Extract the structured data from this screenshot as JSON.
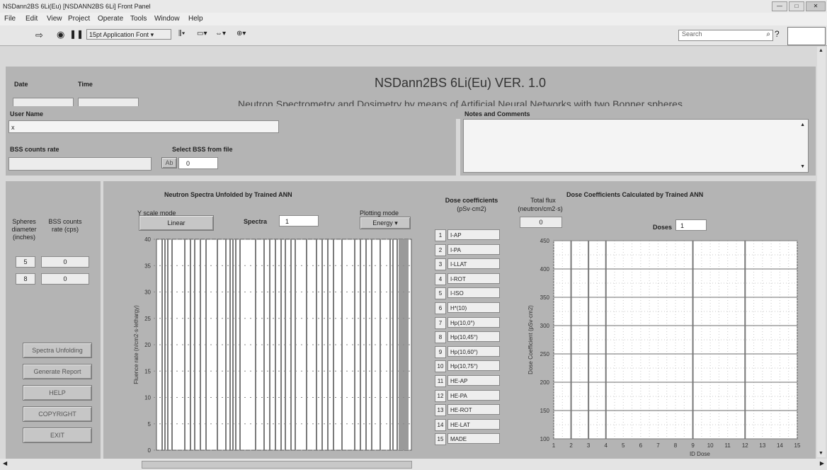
{
  "window": {
    "title": "NSDann2BS 6Li(Eu) [NSDANN2BS 6Li] Front Panel",
    "controls": [
      "—",
      "□",
      "✕"
    ]
  },
  "menu": [
    "File",
    "Edit",
    "View",
    "Project",
    "Operate",
    "Tools",
    "Window",
    "Help"
  ],
  "toolbar": {
    "font_select": "15pt Application Font",
    "search_placeholder": "Search"
  },
  "header": {
    "date_label": "Date",
    "time_label": "Time",
    "date_value": "",
    "time_value": "",
    "title": "NSDann2BS 6Li(Eu) VER. 1.0",
    "subtitle": "Neutron Spectrometry and Dosimetry by means of Artificial Neural Networks with two Bonner spheres"
  },
  "user": {
    "label": "User Name",
    "value": "x",
    "bss_label": "BSS counts rate",
    "bss_value": "",
    "select_label": "Select BSS from file",
    "select_button": "Ab",
    "select_value": "0"
  },
  "notes": {
    "label": "Notes and Comments",
    "value": ""
  },
  "spheres": {
    "header_diameter": "Spheres diameter (inches)",
    "header_counts": "BSS counts rate (cps)",
    "rows": [
      {
        "diameter": "5",
        "counts": "0"
      },
      {
        "diameter": "8",
        "counts": "0"
      }
    ]
  },
  "actions": [
    "Spectra Unfolding",
    "Generate Report",
    "HELP",
    "COPYRIGHT",
    "EXIT"
  ],
  "spectrum": {
    "title": "Neutron Spectra Unfolded by Trained ANN",
    "y_scale_label": "Y scale mode",
    "y_scale_value": "Linear",
    "spectra_label": "Spectra",
    "spectra_value": "1",
    "plotting_label": "Plotting mode",
    "plotting_value": "Energy",
    "ylabel": "Fluence rate (n/cm2·s·lethargy)"
  },
  "coefficients": {
    "title": "Dose coefficients",
    "unit": "(pSv·cm2)",
    "items": [
      {
        "n": "1",
        "name": "I-AP"
      },
      {
        "n": "2",
        "name": "I-PA"
      },
      {
        "n": "3",
        "name": "I-LLAT"
      },
      {
        "n": "4",
        "name": "I-ROT"
      },
      {
        "n": "5",
        "name": "I-ISO"
      },
      {
        "n": "6",
        "name": "H*(10)"
      },
      {
        "n": "7",
        "name": "Hp(10,0°)"
      },
      {
        "n": "8",
        "name": "Hp(10,45°)"
      },
      {
        "n": "9",
        "name": "Hp(10,60°)"
      },
      {
        "n": "10",
        "name": "Hp(10,75°)"
      },
      {
        "n": "11",
        "name": "HE-AP"
      },
      {
        "n": "12",
        "name": "HE-PA"
      },
      {
        "n": "13",
        "name": "HE-ROT"
      },
      {
        "n": "14",
        "name": "HE-LAT"
      },
      {
        "n": "15",
        "name": "MADE"
      }
    ]
  },
  "total_flux": {
    "label": "Total flux",
    "unit": "(neutron/cm2·s)",
    "value": "0"
  },
  "dose": {
    "title": "Dose Coefficients Calculated by Trained ANN",
    "doses_label": "Doses",
    "doses_value": "1",
    "ylabel": "Dose Coefficient (pSv·cm2)",
    "xlabel": "ID Dose"
  },
  "chart_data": [
    {
      "type": "bar",
      "title": "Neutron Spectra Unfolded by Trained ANN",
      "ylabel": "Fluence rate (n/cm2·s·lethargy)",
      "yticks": [
        "0",
        "5",
        "10",
        "15",
        "20",
        "25",
        "30",
        "35",
        "40"
      ],
      "ylim": [
        0,
        40
      ],
      "values": []
    },
    {
      "type": "scatter",
      "title": "Dose Coefficients Calculated by Trained ANN",
      "xlabel": "ID Dose",
      "ylabel": "Dose Coefficient (pSv·cm2)",
      "xticks": [
        "1",
        "2",
        "3",
        "4",
        "5",
        "6",
        "7",
        "8",
        "9",
        "10",
        "11",
        "12",
        "13",
        "14",
        "15"
      ],
      "yticks": [
        "100",
        "150",
        "200",
        "250",
        "300",
        "350",
        "400",
        "450"
      ],
      "xlim": [
        1,
        15
      ],
      "ylim": [
        100,
        450
      ],
      "values": []
    }
  ]
}
